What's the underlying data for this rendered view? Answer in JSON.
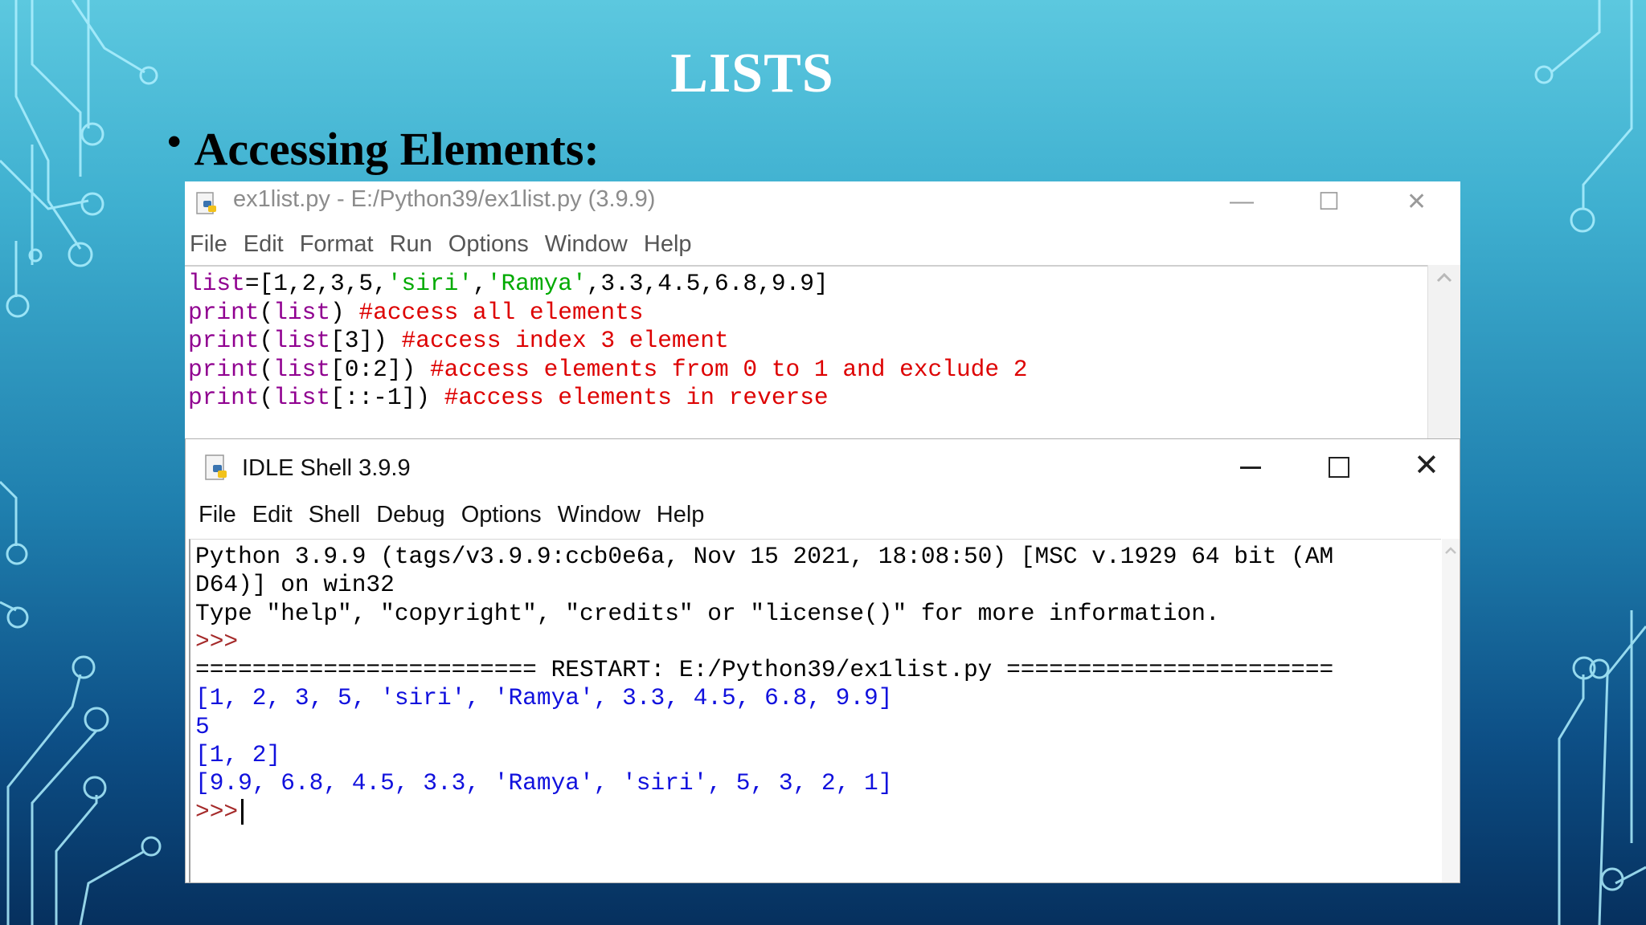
{
  "slide": {
    "title": "LISTS",
    "bullet": "Accessing Elements:"
  },
  "editor": {
    "title": "ex1list.py - E:/Python39/ex1list.py (3.9.9)",
    "menu": [
      "File",
      "Edit",
      "Format",
      "Run",
      "Options",
      "Window",
      "Help"
    ],
    "code": {
      "l1_a": "list",
      "l1_b": "=[1,2,3,5,",
      "l1_c": "'siri'",
      "l1_d": ",",
      "l1_e": "'Ramya'",
      "l1_f": ",3.3,4.5,6.8,9.9]",
      "l2_a": "print",
      "l2_b": "(",
      "l2_c": "list",
      "l2_d": ") ",
      "l2_e": "#access all elements",
      "l3_a": "print",
      "l3_b": "(",
      "l3_c": "list",
      "l3_d": "[3]) ",
      "l3_e": "#access index 3 element",
      "l4_a": "print",
      "l4_b": "(",
      "l4_c": "list",
      "l4_d": "[0:2]) ",
      "l4_e": "#access elements from 0 to 1 and exclude 2",
      "l5_a": "print",
      "l5_b": "(",
      "l5_c": "list",
      "l5_d": "[::-1]) ",
      "l5_e": "#access elements in reverse"
    }
  },
  "shell": {
    "title": "IDLE Shell 3.9.9",
    "menu": [
      "File",
      "Edit",
      "Shell",
      "Debug",
      "Options",
      "Window",
      "Help"
    ],
    "banner1": "Python 3.9.9 (tags/v3.9.9:ccb0e6a, Nov 15 2021, 18:08:50) [MSC v.1929 64 bit (AM",
    "banner2": "D64)] on win32",
    "banner3": "Type \"help\", \"copyright\", \"credits\" or \"license()\" for more information.",
    "prompt": ">>>",
    "restart": "======================== RESTART: E:/Python39/ex1list.py =======================",
    "out1": "[1, 2, 3, 5, 'siri', 'Ramya', 3.3, 4.5, 6.8, 9.9]",
    "out2": "5",
    "out3": "[1, 2]",
    "out4": "[9.9, 6.8, 4.5, 3.3, 'Ramya', 'siri', 5, 3, 2, 1]"
  },
  "colors": {
    "keyword": "#900090",
    "string": "#00aa00",
    "comment": "#dd0000",
    "output": "#1111dd",
    "prompt": "#a52a2a"
  }
}
